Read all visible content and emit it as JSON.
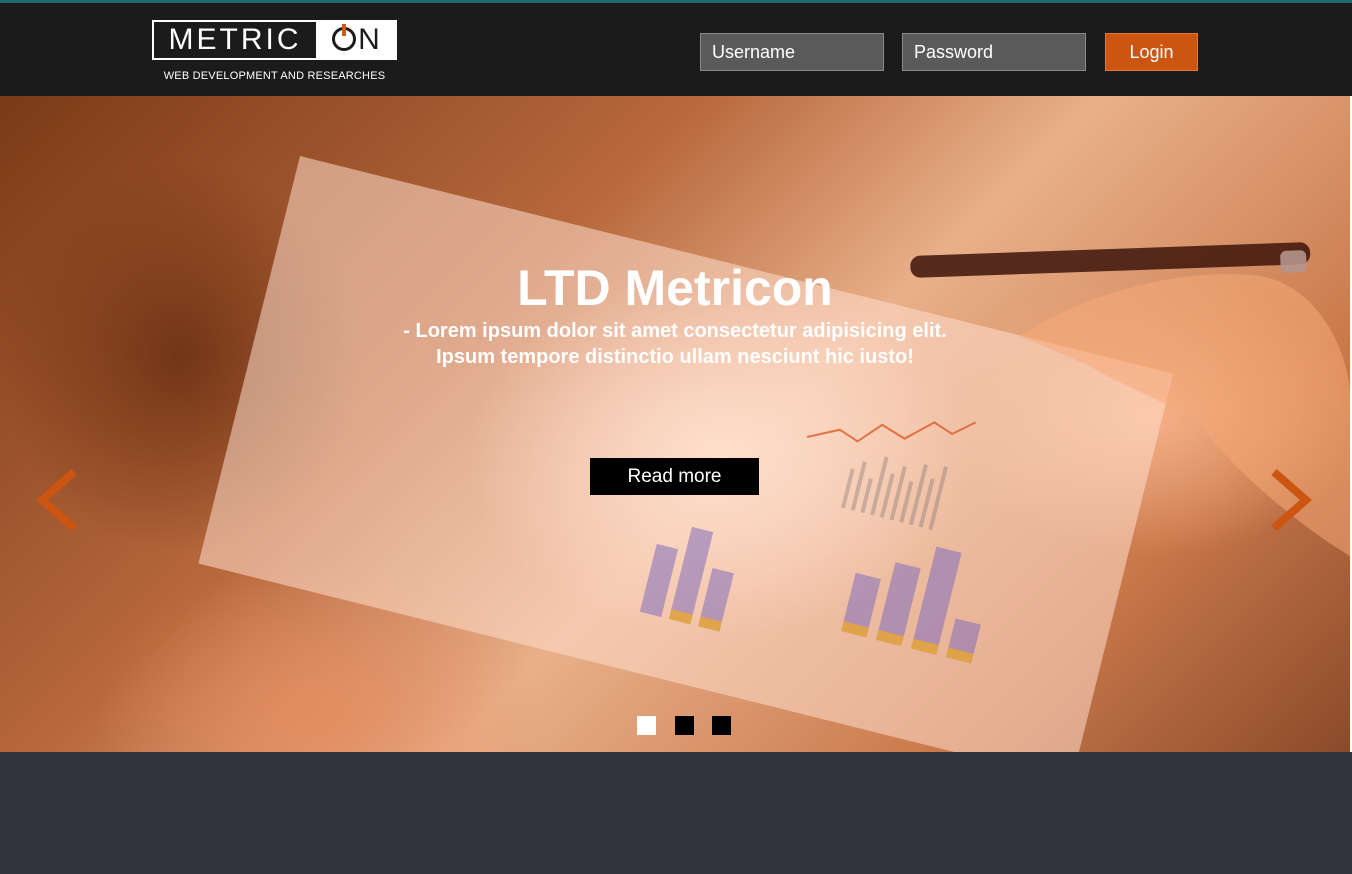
{
  "brand": {
    "logo_left": "METRIC",
    "logo_right": "N",
    "tagline": "WEB DEVELOPMENT AND RESEARCHES",
    "accent_color": "#cb5511"
  },
  "login": {
    "username_placeholder": "Username",
    "password_placeholder": "Password",
    "button_label": "Login"
  },
  "hero": {
    "title": "LTD Metricon",
    "subtitle": "- Lorem ipsum dolor sit amet consectetur adipisicing elit. Ipsum tempore distinctio ullam nesciunt hic iusto!",
    "cta_label": "Read more",
    "prev_icon": "chevron-left-icon",
    "next_icon": "chevron-right-icon",
    "slides_count": 3,
    "active_slide": 1
  }
}
